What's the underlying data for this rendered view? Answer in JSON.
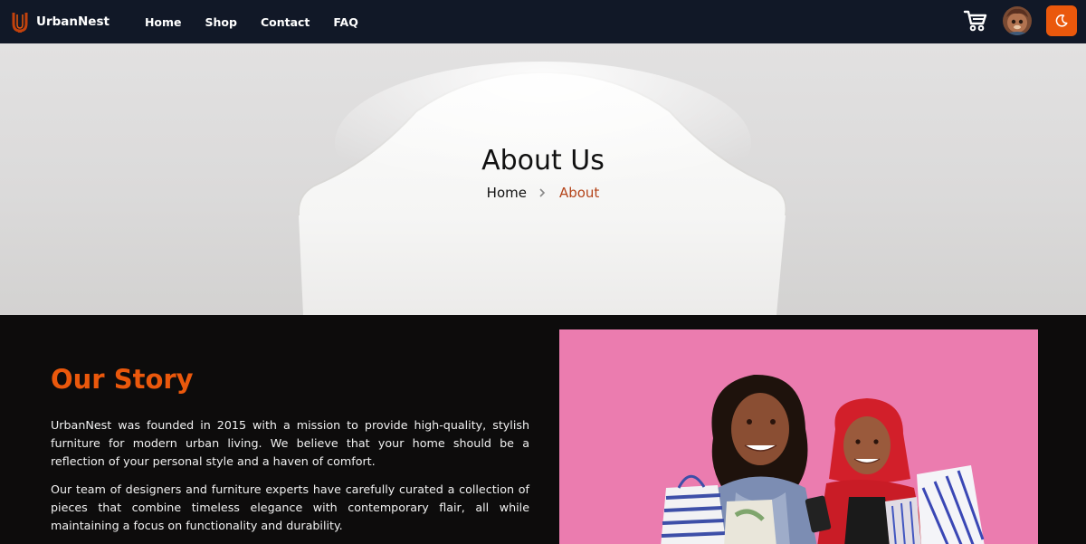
{
  "brand": {
    "name": "UrbanNest",
    "accent": "#ea580c"
  },
  "nav": {
    "links": [
      "Home",
      "Shop",
      "Contact",
      "FAQ"
    ],
    "cart_icon": "cart-icon",
    "avatar": "user-avatar",
    "theme_icon": "moon-icon"
  },
  "hero": {
    "title": "About Us",
    "breadcrumb": {
      "home": "Home",
      "current": "About"
    }
  },
  "story": {
    "title": "Our Story",
    "paragraphs": [
      "UrbanNest was founded in 2015 with a mission to provide high-quality, stylish furniture for modern urban living. We believe that your home should be a reflection of your personal style and a haven of comfort.",
      "Our team of designers and furniture experts have carefully curated a collection of pieces that combine timeless elegance with contemporary flair, all while maintaining a focus on functionality and durability."
    ],
    "photo": "two-women-shopping-photo"
  }
}
